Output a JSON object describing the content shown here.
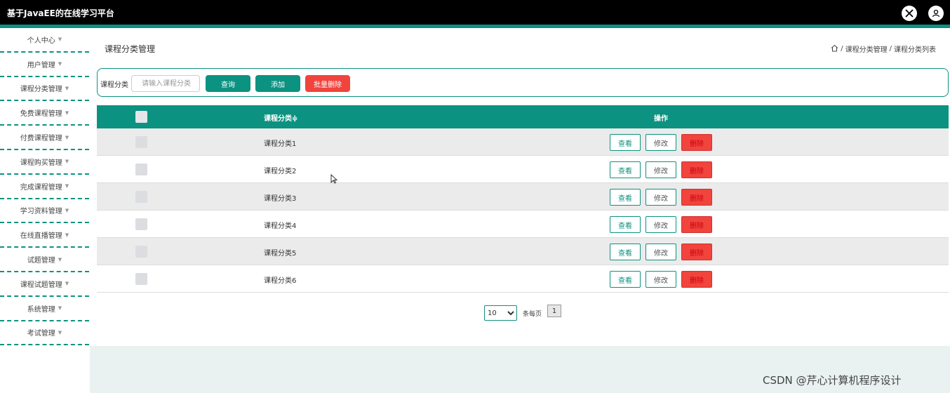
{
  "app": {
    "title": "基于JavaEE的在线学习平台"
  },
  "sidebar": {
    "items": [
      {
        "label": "个人中心"
      },
      {
        "label": "用户管理"
      },
      {
        "label": "课程分类管理"
      },
      {
        "label": "免费课程管理"
      },
      {
        "label": "付费课程管理"
      },
      {
        "label": "课程购买管理"
      },
      {
        "label": "完成课程管理"
      },
      {
        "label": "学习资料管理"
      },
      {
        "label": "在线直播管理"
      },
      {
        "label": "试题管理"
      },
      {
        "label": "课程试题管理"
      },
      {
        "label": "系统管理"
      },
      {
        "label": "考试管理"
      }
    ]
  },
  "page": {
    "title": "课程分类管理",
    "breadcrumb": [
      "课程分类管理",
      "课程分类列表"
    ]
  },
  "search": {
    "label": "课程分类",
    "placeholder": "请输入课程分类",
    "query_label": "查询",
    "add_label": "添加",
    "batch_delete_label": "批量删除"
  },
  "table": {
    "headers": {
      "name": "课程分类",
      "sort_icon": "≑",
      "operation": "操作"
    },
    "rows": [
      {
        "name": "课程分类1"
      },
      {
        "name": "课程分类2"
      },
      {
        "name": "课程分类3"
      },
      {
        "name": "课程分类4"
      },
      {
        "name": "课程分类5"
      },
      {
        "name": "课程分类6"
      }
    ],
    "actions": {
      "view": "查看",
      "edit": "修改",
      "delete": "删除"
    }
  },
  "pagination": {
    "page_size": "10",
    "per_page_label": "条每页",
    "current_page": "1"
  },
  "watermark": "CSDN @芹心计算机程序设计",
  "colors": {
    "primary": "#0c9280",
    "danger": "#f0443d",
    "header_bg": "#000000"
  }
}
